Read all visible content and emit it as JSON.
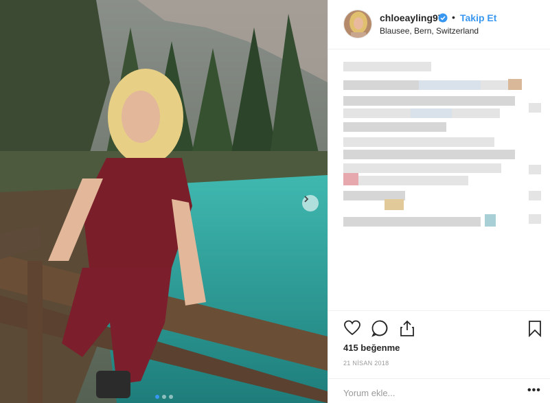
{
  "post": {
    "author": {
      "username": "chloeayling97",
      "verified": true,
      "follow_label": "Takip Et",
      "separator": "•",
      "location": "Blausee, Bern, Switzerland"
    },
    "likes_text": "415 beğenme",
    "date_text": "21 NİSAN 2018",
    "comment": {
      "placeholder": "Yorum ekle...",
      "value": ""
    },
    "more_label": "•••",
    "carousel": {
      "total": 3,
      "active_index": 0
    }
  },
  "icons": {
    "like": "heart-icon",
    "comment": "speech-bubble-icon",
    "share": "share-icon",
    "save": "bookmark-icon",
    "next": "chevron-right-icon",
    "verified": "verified-badge-icon"
  },
  "colors": {
    "accent": "#3897f0",
    "text": "#262626",
    "muted": "#999999",
    "border": "#efefef"
  }
}
